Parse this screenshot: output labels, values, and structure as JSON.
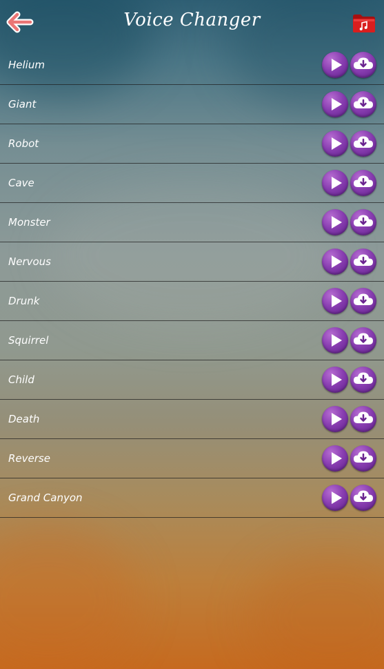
{
  "header": {
    "title": "Voice Changer",
    "back_icon": "arrow-left-icon",
    "folder_icon": "music-folder-icon"
  },
  "effects": [
    {
      "label": "Helium"
    },
    {
      "label": "Giant"
    },
    {
      "label": "Robot"
    },
    {
      "label": "Cave"
    },
    {
      "label": "Monster"
    },
    {
      "label": "Nervous"
    },
    {
      "label": "Drunk"
    },
    {
      "label": "Squirrel"
    },
    {
      "label": "Child"
    },
    {
      "label": "Death"
    },
    {
      "label": "Reverse"
    },
    {
      "label": "Grand Canyon"
    }
  ],
  "icons": {
    "play": "play-icon",
    "download": "cloud-download-icon"
  },
  "colors": {
    "back_arrow": "#ea7575",
    "accent_purple": "#7a2ea6",
    "folder_red": "#d91e1e"
  }
}
